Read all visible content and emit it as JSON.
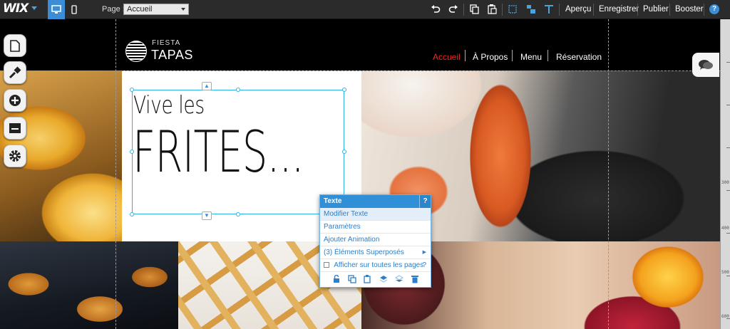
{
  "editor": {
    "logo": "WIX",
    "page_label": "Page :",
    "page_selected": "Accueil",
    "actions": [
      "Aperçu",
      "Enregistrer",
      "Publier",
      "Booster"
    ],
    "help": "?"
  },
  "site": {
    "logo_small": "FIESTA",
    "logo_big": "TAPAS",
    "nav": [
      "Accueil",
      "À Propos",
      "Menu",
      "Réservation"
    ],
    "nav_active_color": "#e52b2b",
    "headline_line1": "Vive les",
    "headline_line2": "FRITES..."
  },
  "context_panel": {
    "title": "Texte",
    "help": "?",
    "items": [
      "Modifier Texte",
      "Paramètres",
      "Ajouter Animation",
      "(3) Éléments Superposés"
    ],
    "checkbox_label": "Afficher sur toutes les pages",
    "checkbox_help": "?"
  },
  "ruler_labels": [
    "300",
    "400",
    "500",
    "600"
  ],
  "icons": {
    "rail": [
      "pages-icon",
      "design-icon",
      "add-icon",
      "app-market-icon",
      "settings-icon"
    ],
    "toolbar": [
      "undo-icon",
      "redo-icon",
      "copy-icon",
      "paste-icon",
      "gridlines-icon",
      "snap-icon",
      "toolbar-icon"
    ],
    "panel_tools": [
      "lock-icon",
      "duplicate-icon",
      "copy-icon",
      "bring-forward-icon",
      "send-backward-icon",
      "delete-icon"
    ]
  },
  "colors": {
    "accent": "#3b8ed6",
    "selection": "#2fb3e6",
    "panel_header": "#2f90d8"
  }
}
